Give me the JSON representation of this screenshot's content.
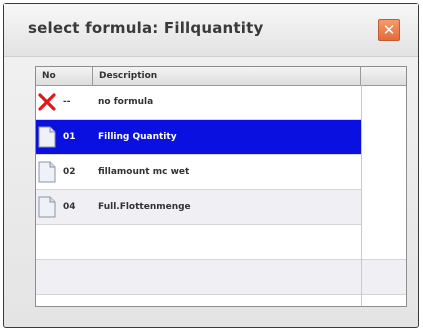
{
  "dialog": {
    "title": "select formula: Fillquantity",
    "close_symbol": "✕"
  },
  "list": {
    "columns": [
      "No",
      "Description",
      ""
    ],
    "rows": [
      {
        "icon": "red-x-icon",
        "no": "--",
        "description": "no formula",
        "selected": false
      },
      {
        "icon": "document-icon",
        "no": "01",
        "description": "Filling Quantity",
        "selected": true
      },
      {
        "icon": "document-icon",
        "no": "02",
        "description": "fillamount mc wet",
        "selected": false
      },
      {
        "icon": "document-icon",
        "no": "04",
        "description": "Full.Flottenmenge",
        "selected": false
      }
    ]
  },
  "colors": {
    "selection": "#0a10e0",
    "close_button": "#e46a3c"
  }
}
